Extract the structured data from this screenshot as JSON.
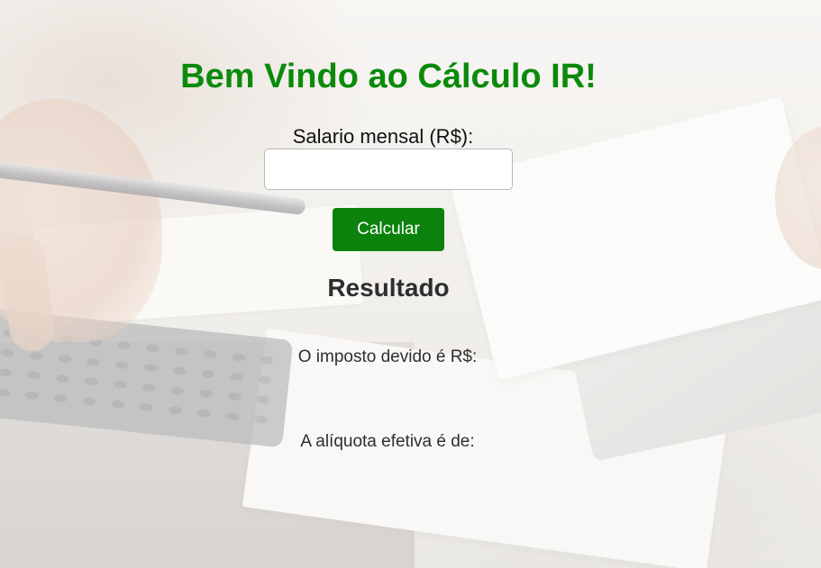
{
  "header": {
    "title": "Bem Vindo ao Cálculo IR!"
  },
  "form": {
    "salary_label": "Salario mensal (R$):",
    "salary_value": "",
    "calculate_label": "Calcular"
  },
  "result": {
    "heading": "Resultado",
    "tax_due_label": "O imposto devido é R$:",
    "effective_rate_label": "A alíquota efetiva é de:"
  },
  "colors": {
    "title_green": "#0b8a0b",
    "button_green": "#0b820b",
    "text_dark": "#2e2e2e"
  }
}
